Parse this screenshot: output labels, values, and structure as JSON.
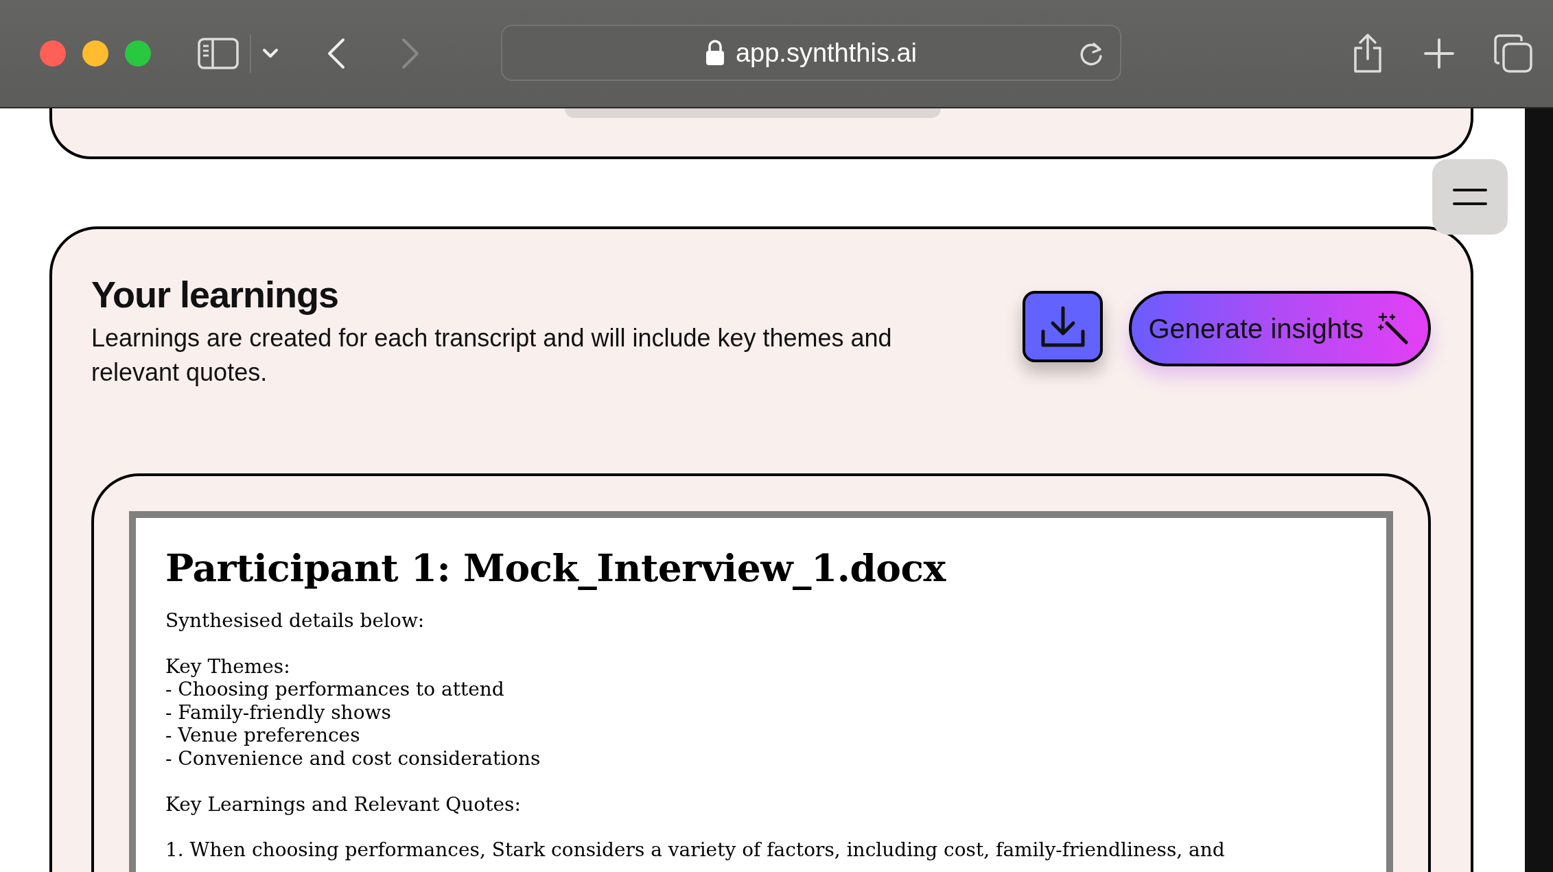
{
  "browser": {
    "url": "app.synththis.ai"
  },
  "learnings": {
    "title": "Your learnings",
    "description": "Learnings are created for each transcript and will include key themes and relevant quotes.",
    "generate_button": "Generate insights"
  },
  "document": {
    "title": "Participant 1: Mock_Interview_1.docx",
    "blocks": [
      [
        "Synthesised details below:"
      ],
      [
        "Key Themes:",
        "- Choosing performances to attend",
        "- Family-friendly shows",
        "- Venue preferences",
        "- Convenience and cost considerations"
      ],
      [
        "Key Learnings and Relevant Quotes:"
      ],
      [
        "1. When choosing performances, Stark considers a variety of factors, including cost, family-friendliness, and"
      ]
    ]
  }
}
